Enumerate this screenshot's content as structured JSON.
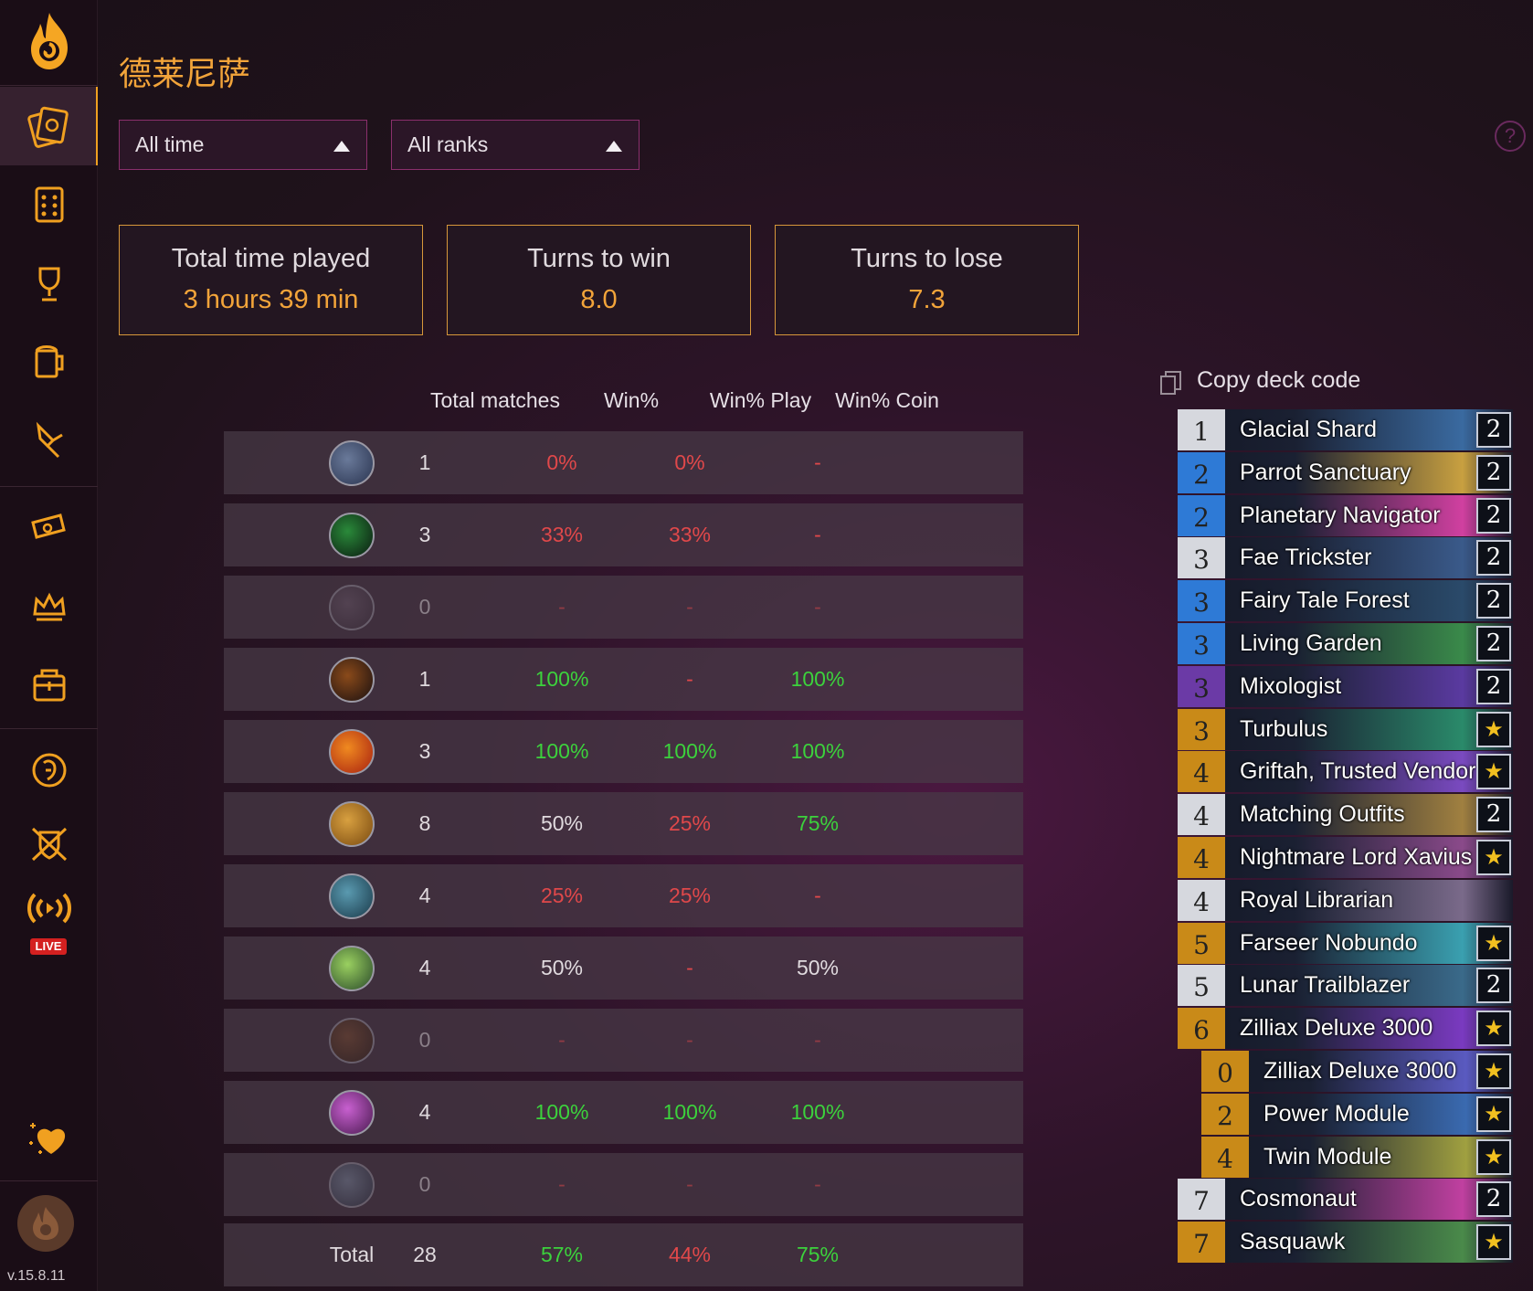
{
  "header": {
    "title": "德莱尼萨",
    "time_filter": "All time",
    "rank_filter": "All ranks",
    "help": "?"
  },
  "stats": [
    {
      "label": "Total time played",
      "value": "3 hours 39 min"
    },
    {
      "label": "Turns to win",
      "value": "8.0"
    },
    {
      "label": "Turns to lose",
      "value": "7.3"
    }
  ],
  "table": {
    "headers": [
      "Total matches",
      "Win%",
      "Win% Play",
      "Win% Coin"
    ],
    "rows": [
      {
        "matches": "1",
        "win": "0%",
        "play": "0%",
        "coin": "-"
      },
      {
        "matches": "3",
        "win": "33%",
        "play": "33%",
        "coin": "-"
      },
      {
        "matches": "0",
        "win": "-",
        "play": "-",
        "coin": "-"
      },
      {
        "matches": "1",
        "win": "100%",
        "play": "-",
        "coin": "100%"
      },
      {
        "matches": "3",
        "win": "100%",
        "play": "100%",
        "coin": "100%"
      },
      {
        "matches": "8",
        "win": "50%",
        "play": "25%",
        "coin": "75%"
      },
      {
        "matches": "4",
        "win": "25%",
        "play": "25%",
        "coin": "-"
      },
      {
        "matches": "4",
        "win": "50%",
        "play": "-",
        "coin": "50%"
      },
      {
        "matches": "0",
        "win": "-",
        "play": "-",
        "coin": "-"
      },
      {
        "matches": "4",
        "win": "100%",
        "play": "100%",
        "coin": "100%"
      },
      {
        "matches": "0",
        "win": "-",
        "play": "-",
        "coin": "-"
      }
    ],
    "total": {
      "label": "Total",
      "matches": "28",
      "win": "57%",
      "play": "44%",
      "coin": "75%"
    }
  },
  "colors": {
    "accent": "#f2a43a",
    "win": "#3cd23c",
    "loss": "#e0484a",
    "neutral": "#e0dade",
    "dim": "#8a7f88"
  },
  "deck": {
    "copy_label": "Copy deck code",
    "cards": [
      {
        "cost": "1",
        "name": "Glacial Shard",
        "count": "2"
      },
      {
        "cost": "2",
        "name": "Parrot Sanctuary",
        "count": "2"
      },
      {
        "cost": "2",
        "name": "Planetary Navigator",
        "count": "2"
      },
      {
        "cost": "3",
        "name": "Fae Trickster",
        "count": "2"
      },
      {
        "cost": "3",
        "name": "Fairy Tale Forest",
        "count": "2"
      },
      {
        "cost": "3",
        "name": "Living Garden",
        "count": "2"
      },
      {
        "cost": "3",
        "name": "Mixologist",
        "count": "2"
      },
      {
        "cost": "3",
        "name": "Turbulus",
        "count": "★"
      },
      {
        "cost": "4",
        "name": "Griftah, Trusted Vendor",
        "count": "★"
      },
      {
        "cost": "4",
        "name": "Matching Outfits",
        "count": "2"
      },
      {
        "cost": "4",
        "name": "Nightmare Lord Xavius",
        "count": "★"
      },
      {
        "cost": "4",
        "name": "Royal Librarian",
        "count": ""
      },
      {
        "cost": "5",
        "name": "Farseer Nobundo",
        "count": "★"
      },
      {
        "cost": "5",
        "name": "Lunar Trailblazer",
        "count": "2"
      },
      {
        "cost": "6",
        "name": "Zilliax Deluxe 3000",
        "count": "★"
      },
      {
        "cost": "0",
        "name": "Zilliax Deluxe 3000",
        "count": "★"
      },
      {
        "cost": "2",
        "name": "Power Module",
        "count": "★"
      },
      {
        "cost": "4",
        "name": "Twin Module",
        "count": "★"
      },
      {
        "cost": "7",
        "name": "Cosmonaut",
        "count": "2"
      },
      {
        "cost": "7",
        "name": "Sasquawk",
        "count": "★"
      }
    ]
  },
  "sidebar": {
    "live_label": "LIVE",
    "version": "v.15.8.11"
  }
}
